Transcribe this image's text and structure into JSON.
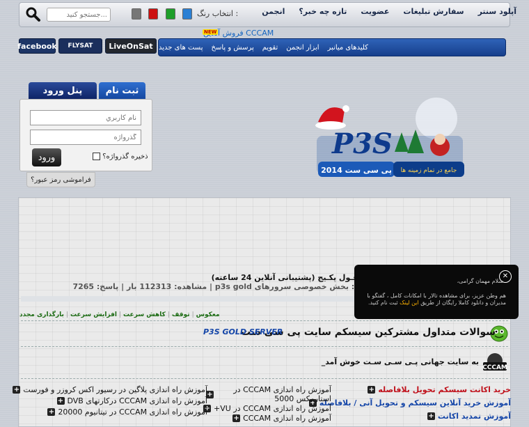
{
  "topbar": {
    "nav": [
      "انجمن",
      "تازه چه خبر؟",
      "عضویت",
      "سفارش تبلیغات",
      "آپلود سنتر"
    ],
    "color_label": "انتخاب رنگ :",
    "color_swatches": [
      "#2a7fd4",
      "#cc1111",
      "#1e9e2a",
      "#777777"
    ],
    "search_placeholder": "جستجو کنید..."
  },
  "promo": {
    "text": "فروش آنلاین CCCAM",
    "badge": "NEW"
  },
  "social": [
    "facebook",
    "FLYSAT",
    "LiveOnSat"
  ],
  "mainnav": [
    "پست های جدید",
    "پرسش و پاسخ",
    "تقویم",
    "ابزار انجمن",
    "کلیدهای میانبر"
  ],
  "login": {
    "tab_login": "پنل ورود",
    "tab_register": "ثبت نام",
    "username_placeholder": "نام کاربري",
    "password_placeholder": "گذرواژه",
    "remember": "ذخیره گذرواژه؟",
    "submit": "ورود",
    "forgot": "فراموشی رمز عبور؟"
  },
  "logo": {
    "text": "پی سی ست 2014",
    "banner": "جامع در تمام زمینه ها"
  },
  "thread": {
    "title": "های فـول پکـیج (پشتیبانی آنلاین 24 ساعته)",
    "meta": "مکان: بخش خصوصی سرورهای p3s gold | مشاهده: 112313 بار | پاسخ: 7265"
  },
  "tools": [
    "بارگذاری مجدد",
    "افزایش سرعت",
    "کاهش سرعت",
    "توقف",
    "معکوس"
  ],
  "faq": {
    "title": "سوالات متداول مشترکین سیسکم سایت پی سی ست",
    "gold": "P3S GOLD SERVER"
  },
  "welcome": "به سایت جهانی پـی سـی سـت خوش آمد_",
  "links_right": [
    "خرید اکانت سیسکم تحویل بلافاصله",
    "آموزش خرید آنلاین سیسکم و تحویل آنی / بلافاصله",
    "آموزش تمدید اکانت"
  ],
  "links_mid": [
    "آموزش راه اندازی CCCAM در استارمکس 5000",
    "آموزش راه اندازی CCCAM در VU+",
    "آموزش راه اندازی CCCAM"
  ],
  "links_left": [
    "آموزش راه اندازی پلاگین در رسیور اکس کروزر و فورست",
    "آموزش راه اندازی CCCAM درکارتهای DVB",
    "آموزش راه اندازی CCCAM در تیتانیوم 20000"
  ],
  "popup": {
    "greeting": "سلام مهمان گرامی،",
    "body_main": "هم وطن عزیز، برای مشاهده تالار با امکانات کامل ، گفتگو با مدیران و دانلود کاملا رایگان از طریق",
    "body_link": "این لینک",
    "body_end": "ثبت نام کنید.",
    "close": "✕"
  }
}
